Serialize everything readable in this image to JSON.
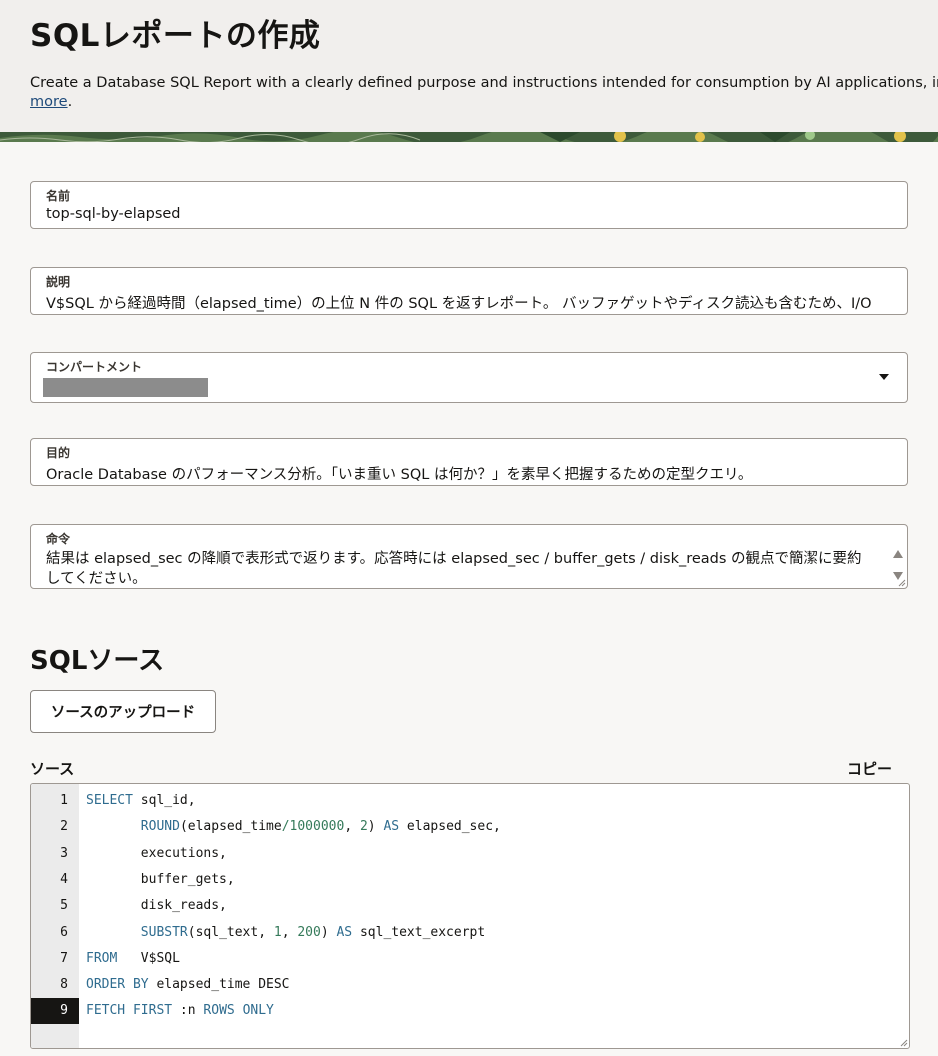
{
  "header": {
    "title": "SQLレポートの作成",
    "description": "Create a Database SQL Report with a clearly defined purpose and instructions intended for consumption by AI applications, including r",
    "more_link": "more",
    "period": "."
  },
  "form": {
    "name": {
      "label": "名前",
      "value": "top-sql-by-elapsed"
    },
    "description": {
      "label": "説明",
      "value": "V$SQL から経過時間（elapsed_time）の上位 N 件の SQL を返すレポート。 バッファゲットやディスク読込も含むため、I/O"
    },
    "compartment": {
      "label": "コンパートメント",
      "value": ""
    },
    "purpose": {
      "label": "目的",
      "value": "Oracle Database のパフォーマンス分析。「いま重い SQL は何か？」を素早く把握するための定型クエリ。"
    },
    "instructions": {
      "label": "命令",
      "value": "結果は elapsed_sec の降順で表形式で返ります。応答時には elapsed_sec / buffer_gets / disk_reads の観点で簡潔に要約してください。"
    }
  },
  "sql_source": {
    "title": "SQLソース",
    "upload_button": "ソースのアップロード",
    "source_label": "ソース",
    "copy_label": "コピー",
    "active_line": 9,
    "lines": [
      "SELECT sql_id,",
      "       ROUND(elapsed_time/1000000, 2) AS elapsed_sec,",
      "       executions,",
      "       buffer_gets,",
      "       disk_reads,",
      "       SUBSTR(sql_text, 1, 200) AS sql_text_excerpt",
      "FROM   V$SQL",
      "ORDER BY elapsed_time DESC",
      "FETCH FIRST :n ROWS ONLY"
    ]
  }
}
